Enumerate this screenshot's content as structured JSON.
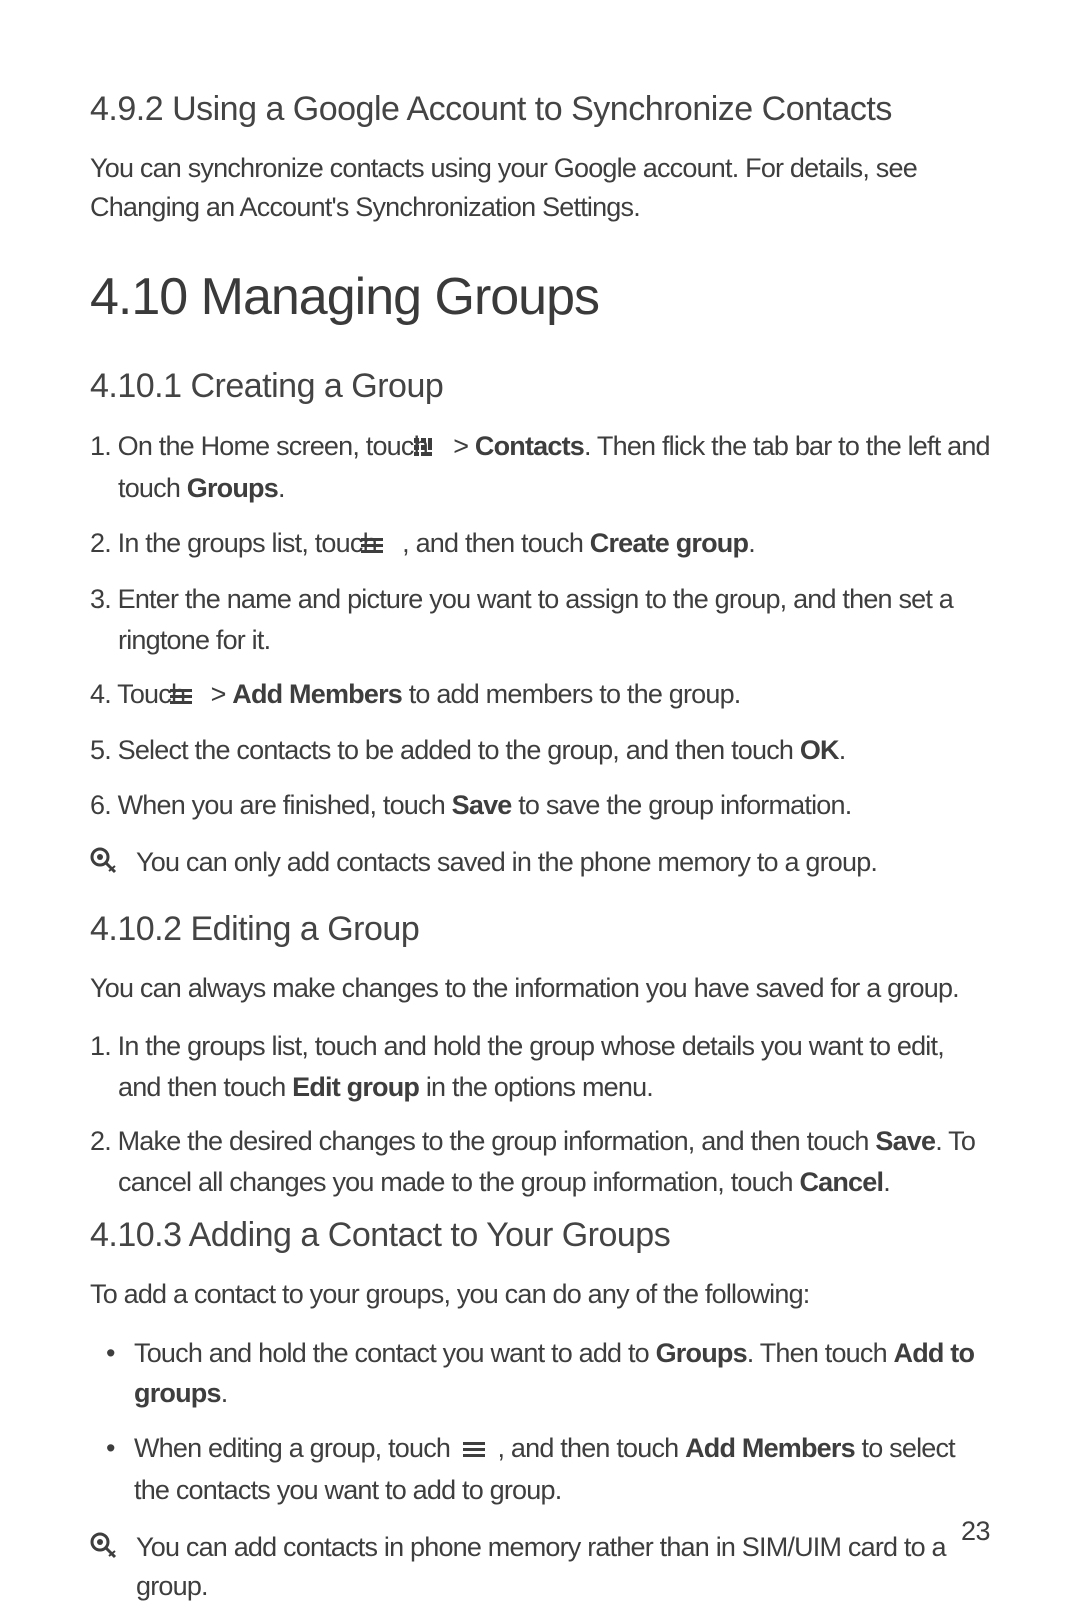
{
  "section_492": {
    "heading": "4.9.2  Using a Google Account to Synchronize Contacts",
    "para": "You can synchronize contacts using your Google account. For details, see Changing an Account's Synchronization Settings."
  },
  "section_410": {
    "heading": "4.10  Managing Groups"
  },
  "section_4101": {
    "heading": "4.10.1  Creating a Group",
    "step1_a": "1. On the Home screen, touch ",
    "step1_b": " > ",
    "step1_bold1": "Contacts",
    "step1_c": ". Then flick the tab bar to the left and touch ",
    "step1_bold2": "Groups",
    "step1_d": ".",
    "step2_a": "2. In the groups list, touch ",
    "step2_b": " , and then touch ",
    "step2_bold": "Create group",
    "step2_c": ".",
    "step3": "3. Enter the name and picture you want to assign to the group, and then set a ringtone for it.",
    "step4_a": "4. Touch ",
    "step4_b": " > ",
    "step4_bold": "Add Members",
    "step4_c": " to add members to the group.",
    "step5_a": "5. Select the contacts to be added to the group, and then touch ",
    "step5_bold": "OK",
    "step5_b": ".",
    "step6_a": "6. When you are finished, touch ",
    "step6_bold": "Save",
    "step6_b": " to save the group information.",
    "note": "You can only add contacts saved in the phone memory to a group."
  },
  "section_4102": {
    "heading": "4.10.2  Editing a Group",
    "intro": "You can always make changes to the information you have saved for a group.",
    "step1_a": "1. In the groups list, touch and hold the group whose details you want to edit, and then touch ",
    "step1_bold": "Edit group",
    "step1_b": " in the options menu.",
    "step2_a": "2. Make the desired changes to the group information, and then touch ",
    "step2_bold1": "Save",
    "step2_b": ". To cancel all changes you made to the group information, touch ",
    "step2_bold2": "Cancel",
    "step2_c": "."
  },
  "section_4103": {
    "heading": "4.10.3  Adding a Contact to Your Groups",
    "intro": "To add a contact to your groups, you can do any of the following:",
    "bullet1_a": "Touch and hold the contact you want to add to ",
    "bullet1_bold1": "Groups",
    "bullet1_b": ". Then touch ",
    "bullet1_bold2": "Add to groups",
    "bullet1_c": ".",
    "bullet2_a": "When editing a group, touch ",
    "bullet2_b": " , and then touch ",
    "bullet2_bold": "Add Members",
    "bullet2_c": " to select the contacts you want to add to group.",
    "note": "You can add contacts in phone memory rather than in SIM/UIM card to a group."
  },
  "page_number": "23"
}
